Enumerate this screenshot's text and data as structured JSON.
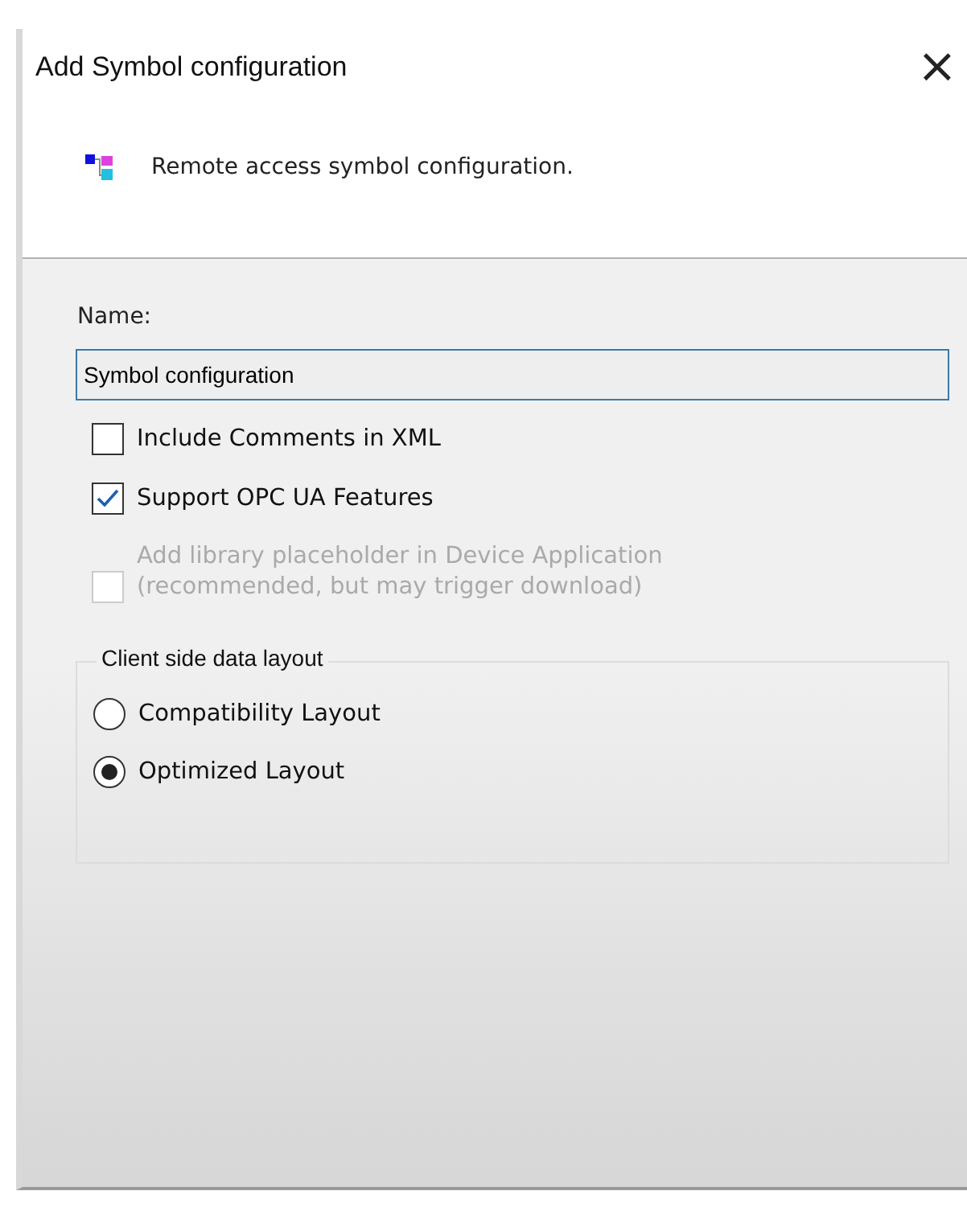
{
  "window": {
    "title": "Add Symbol configuration",
    "close": "×"
  },
  "header": {
    "description": "Remote access symbol configuration."
  },
  "name_field": {
    "label": "Name:",
    "value": "Symbol configuration"
  },
  "options": [
    {
      "label": "Include Comments in XML",
      "checked": false,
      "disabled": false
    },
    {
      "label": "Support OPC UA Features",
      "checked": true,
      "disabled": false
    },
    {
      "label": "Add library placeholder in Device Application\n(recommended, but may trigger download)",
      "checked": false,
      "disabled": true
    }
  ],
  "layout_group": {
    "title": "Client side data layout",
    "options": [
      {
        "label": "Compatibility Layout",
        "selected": false
      },
      {
        "label": "Optimized Layout",
        "selected": true
      }
    ]
  }
}
